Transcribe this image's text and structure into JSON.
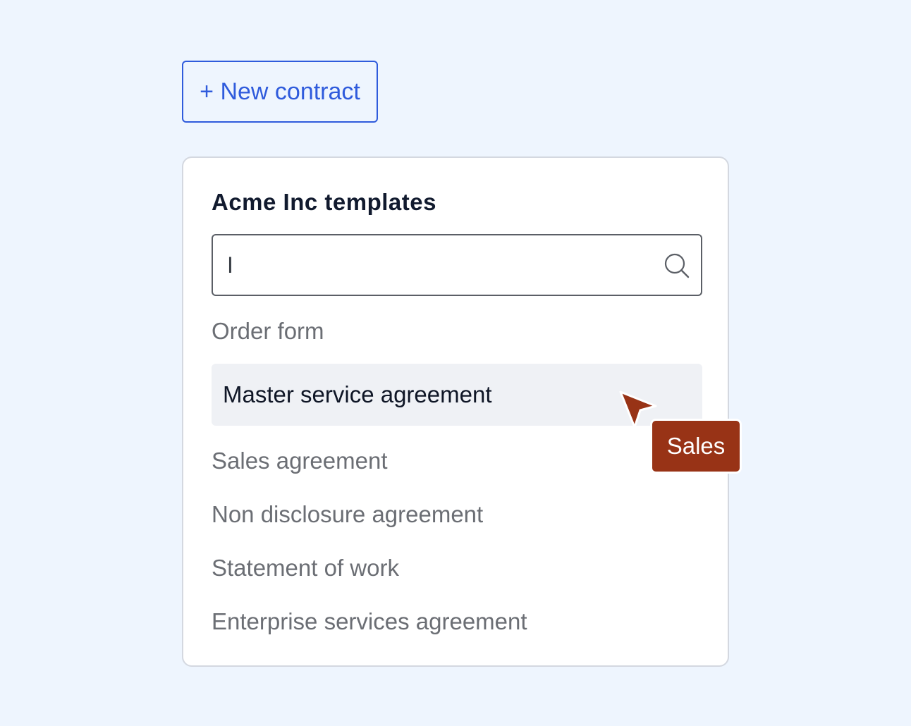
{
  "toolbar": {
    "new_contract_label": "+ New contract"
  },
  "templates_panel": {
    "title": "Acme Inc templates",
    "search": {
      "value": "I",
      "icon": "search-icon"
    },
    "items": [
      {
        "label": "Order form",
        "active": false
      },
      {
        "label": "Master service agreement",
        "active": true
      },
      {
        "label": "Sales agreement",
        "active": false
      },
      {
        "label": "Non disclosure agreement",
        "active": false
      },
      {
        "label": "Statement of work",
        "active": false
      },
      {
        "label": "Enterprise services agreement",
        "active": false
      }
    ]
  },
  "collaborator_cursor": {
    "name": "Sales",
    "color": "#983316",
    "icon": "pointer-arrow-icon"
  },
  "colors": {
    "background": "#eef5fe",
    "accent": "#2f5bdc",
    "active_row": "#eff1f5"
  }
}
